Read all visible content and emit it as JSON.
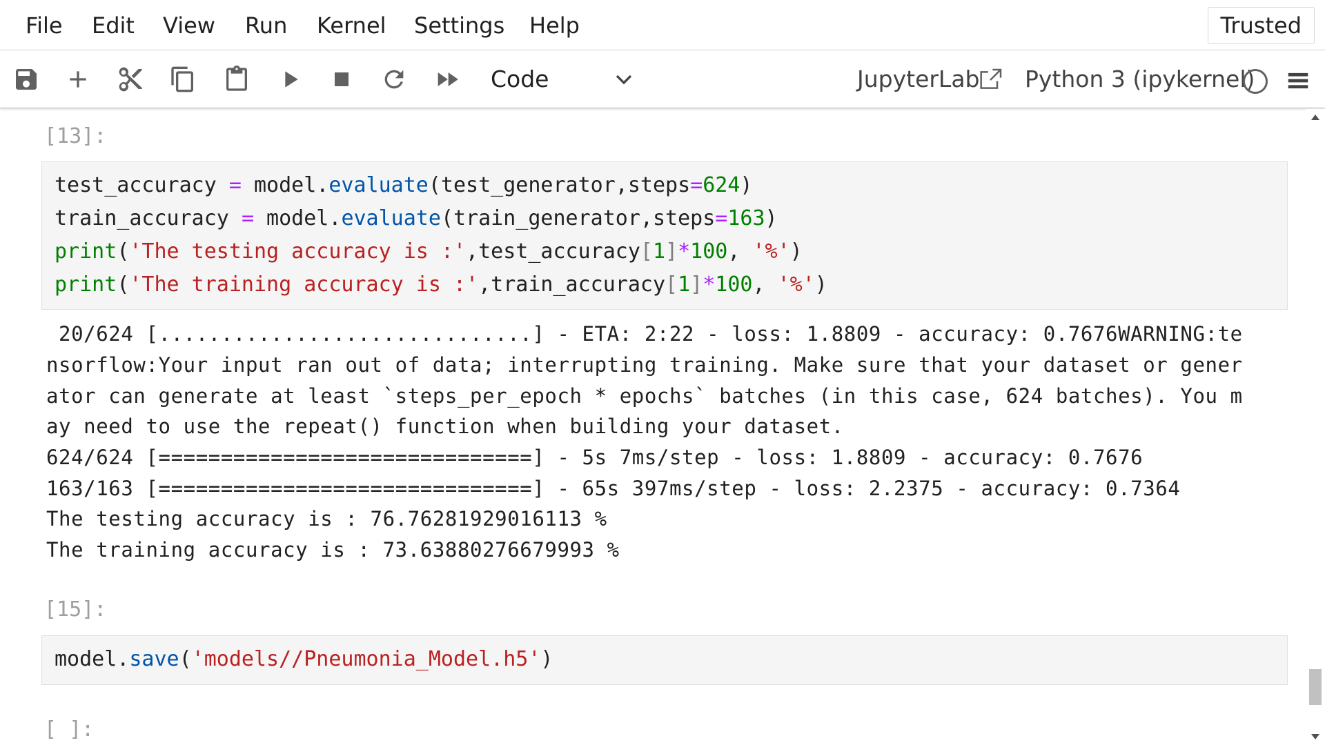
{
  "menubar": {
    "items": [
      "File",
      "Edit",
      "View",
      "Run",
      "Kernel",
      "Settings",
      "Help"
    ],
    "trusted_label": "Trusted"
  },
  "toolbar": {
    "buttons": [
      "save-icon",
      "plus-icon",
      "scissors-icon",
      "copy-icon",
      "paste-icon",
      "run-icon",
      "stop-icon",
      "restart-icon",
      "fast-forward-icon"
    ],
    "cell_type": "Code",
    "jupyterlab_label": "JupyterLab",
    "kernel_name": "Python 3 (ipykernel)"
  },
  "cells": [
    {
      "prompt": "[13]:",
      "code": [
        "test_accuracy = model.evaluate(test_generator,steps=624)",
        "train_accuracy = model.evaluate(train_generator,steps=163)",
        "print('The testing accuracy is :',test_accuracy[1]*100, '%')",
        "print('The training accuracy is :',train_accuracy[1]*100, '%')"
      ],
      "output": [
        " 20/624 [..............................] - ETA: 2:22 - loss: 1.8809 - accuracy: 0.7676WARNING:te",
        "nsorflow:Your input ran out of data; interrupting training. Make sure that your dataset or gener",
        "ator can generate at least `steps_per_epoch * epochs` batches (in this case, 624 batches). You m",
        "ay need to use the repeat() function when building your dataset.",
        "624/624 [==============================] - 5s 7ms/step - loss: 1.8809 - accuracy: 0.7676",
        "163/163 [==============================] - 65s 397ms/step - loss: 2.2375 - accuracy: 0.7364",
        "The testing accuracy is : 76.76281929016113 %",
        "The training accuracy is : 73.63880276679993 %"
      ]
    },
    {
      "prompt": "[15]:",
      "code": [
        "model.save('models//Pneumonia_Model.h5')"
      ]
    },
    {
      "prompt": "[ ]:"
    }
  ],
  "colors": {
    "builtin": "#008000",
    "method": "#0055aa",
    "operator": "#aa22ff",
    "string": "#ba2121",
    "prompt": "#9e9e9e"
  }
}
